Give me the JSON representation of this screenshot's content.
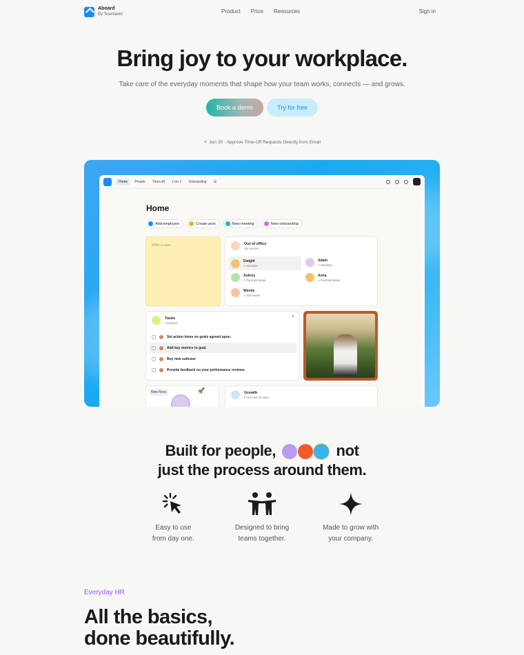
{
  "nav": {
    "brand_name": "Aboard",
    "brand_sub": "By Teamtailor",
    "links": [
      "Product",
      "Price",
      "Resources"
    ],
    "signin": "Sign in"
  },
  "hero": {
    "title": "Bring joy to your workplace.",
    "subtitle": "Take care of the everyday moments that shape how your team works, connects — and grows.",
    "cta_demo": "Book a demo",
    "cta_free": "Try for free",
    "announcement": "Jun 30 · Approve Time-Off Requests Directly from Email"
  },
  "app": {
    "tabs": [
      "Home",
      "People",
      "Time-off",
      "1-on-1",
      "Onboarding"
    ],
    "active_tab": "Home",
    "page_title": "Home",
    "quick_actions": [
      "Add employee",
      "Create post",
      "New meeting",
      "New onboarding"
    ],
    "note_placeholder": "Write a note...",
    "ooo": {
      "title": "Out of office",
      "subtitle": "My reports",
      "people": [
        {
          "name": "Dwight",
          "status": "Vacation"
        },
        {
          "name": "Adam",
          "status": "Vacation"
        },
        {
          "name": "Aubrey",
          "status": "Parental leave"
        },
        {
          "name": "Anna",
          "status": "Parental leave"
        },
        {
          "name": "Wendy",
          "status": "Sick leave"
        }
      ]
    },
    "tasks": {
      "title": "Tasks",
      "subtitle": "Assigned",
      "items": [
        "Set action items on goals agreed upon.",
        "Add key metrics to goal.",
        "Buy new suitcase",
        "Provide feedback on your performance reviews."
      ]
    },
    "new_hires_label": "New hires",
    "growth": {
      "title": "Growth",
      "subtitle": "In the last 30 days"
    }
  },
  "built": {
    "line1_a": "Built for people,",
    "line1_b": "not",
    "line2": "just the process around them."
  },
  "features": [
    {
      "icon": "click-burst-icon",
      "text": "Easy to use\nfrom day one."
    },
    {
      "icon": "people-together-icon",
      "text": "Designed to bring\nteams together."
    },
    {
      "icon": "sparkle-icon",
      "text": "Made to grow with\nyour company."
    }
  ],
  "everyday": {
    "eyebrow": "Everyday HR",
    "heading": "All the basics,\ndone beautifully."
  },
  "colors": {
    "brand_blue": "#1a8cf0",
    "accent_purple": "#9b59e6",
    "frame_blue": "#1aa9f0"
  }
}
